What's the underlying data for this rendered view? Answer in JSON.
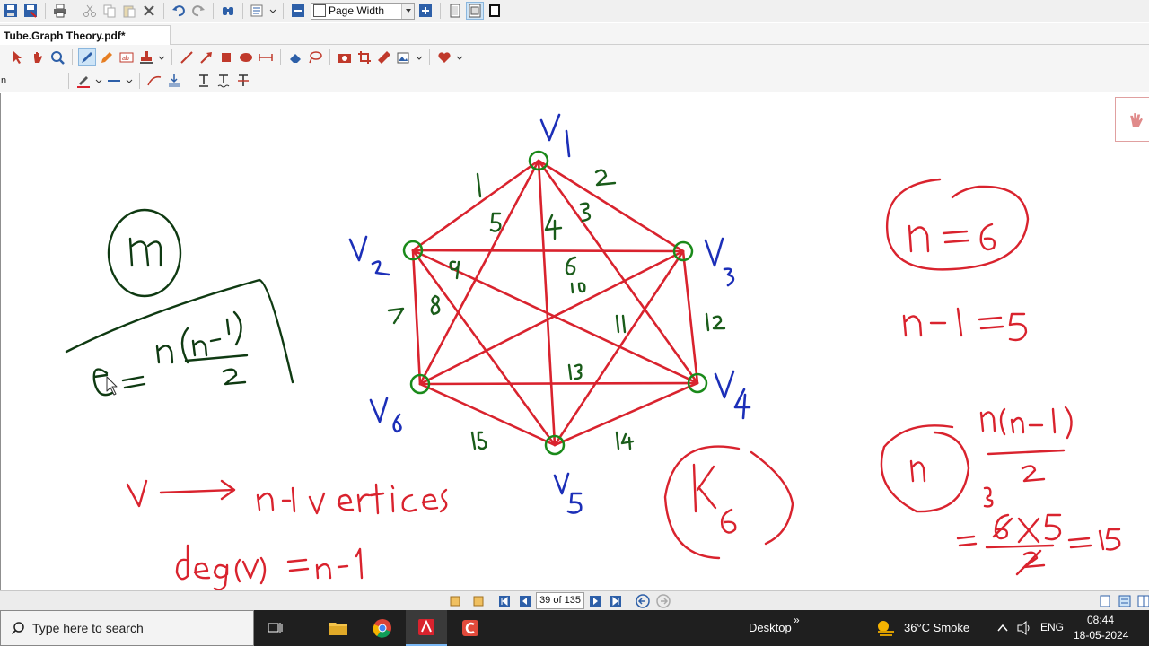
{
  "window": {
    "doc_tab_title": "Tube.Graph Theory.pdf*",
    "tab_close_glyph": "×",
    "zoom_value": "Page Width",
    "left_panel_label": "n"
  },
  "toolbar1_icons": [
    "save-icon",
    "save-as-icon",
    "print-icon",
    "cut-icon",
    "copy-icon",
    "paste-icon",
    "delete-icon",
    "undo-icon",
    "redo-icon",
    "find-icon",
    "properties-icon",
    "zoom-out-icon",
    "zoom-in-icon",
    "single-page-icon",
    "two-page-icon",
    "fullscreen-icon"
  ],
  "navigation": {
    "page_indicator": "39 of 135"
  },
  "taskbar": {
    "search_placeholder": "Type here to search",
    "desktop_label": "Desktop",
    "desktop_chevron": "»",
    "weather": "36°C  Smoke",
    "language": "ENG",
    "time": "08:44",
    "date": "18-05-2024"
  },
  "handwriting": {
    "vertices": [
      "V1",
      "V2",
      "V3",
      "V4",
      "V5",
      "V6"
    ],
    "edge_numbers": [
      "1",
      "2",
      "3",
      "4",
      "5",
      "6",
      "7",
      "8",
      "9",
      "10",
      "11",
      "12",
      "13",
      "14",
      "15"
    ],
    "formula_left": "e = n(n-1)/2",
    "circled_n": "n",
    "bottom_line1": "v ⟶ n-1 vertices",
    "bottom_line2": "deg(v) = n-1",
    "n_equals": "n=6",
    "n_minus_1": "n-1 =5",
    "k6": "K6",
    "calc_fraction": "n(n-1)/2",
    "calc_result": "= 6×5/2 = 15"
  },
  "colors": {
    "ink_red": "#d9232e",
    "ink_green": "#1a5c1a",
    "ink_blue": "#1c2fb8",
    "taskbar": "#1f1f1f",
    "toolbar": "#f0f0f0"
  }
}
